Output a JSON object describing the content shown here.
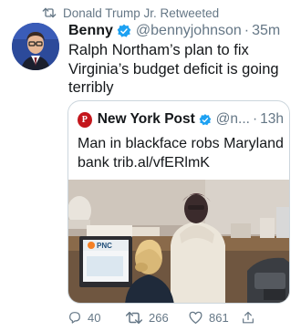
{
  "retweet": {
    "text": "Donald Trump Jr. Retweeted",
    "icon": "retweet-icon"
  },
  "tweet": {
    "author_name": "Benny",
    "handle": "@bennyjohnson",
    "separator": "·",
    "time": "35m",
    "text": "Ralph Northam’s plan to fix Virginia’s budget deficit is going terribly",
    "verified_icon": "verified-badge-icon"
  },
  "quote": {
    "author_name": "New York Post",
    "handle": "@n...",
    "separator": "·",
    "time": "13h",
    "text": "Man in blackface robs Maryland bank trib.al/vfERlmK",
    "logo_text": "P",
    "image_text": "PNC"
  },
  "actions": {
    "replies": "40",
    "retweets": "266",
    "likes": "861"
  },
  "colors": {
    "verified": "#1da1f2",
    "secondary_text": "#657786",
    "nypost_red": "#c4161c"
  }
}
